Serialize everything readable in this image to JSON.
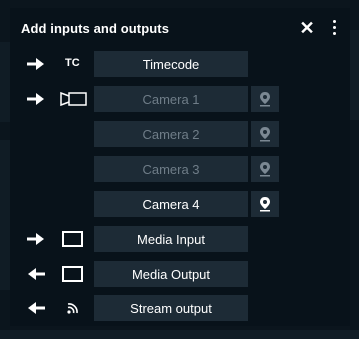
{
  "dialog": {
    "title": "Add inputs and outputs",
    "close_glyph": "✕"
  },
  "rows": [
    {
      "direction": "input",
      "icon": "tc-label",
      "tc_text": "TC",
      "label": "Timecode",
      "enabled": true
    },
    {
      "direction": "input",
      "icon": "camera-icon",
      "label": "Camera 1",
      "enabled": false,
      "location_enabled": false
    },
    {
      "direction": "none",
      "label": "Camera 2",
      "enabled": false,
      "location_enabled": false
    },
    {
      "direction": "none",
      "label": "Camera 3",
      "enabled": false,
      "location_enabled": false
    },
    {
      "direction": "none",
      "label": "Camera 4",
      "enabled": true,
      "location_enabled": true
    },
    {
      "direction": "input",
      "icon": "monitor-icon",
      "label": "Media Input",
      "enabled": true
    },
    {
      "direction": "output",
      "icon": "monitor-icon",
      "label": "Media Output",
      "enabled": true
    },
    {
      "direction": "output",
      "icon": "stream-icon",
      "label": "Stream output",
      "enabled": true
    }
  ],
  "colors": {
    "panel": "#08121a",
    "button": "#1d2b36",
    "text": "#ffffff",
    "disabled_text": "#6f7d88",
    "disabled_icon": "#7b8893"
  }
}
